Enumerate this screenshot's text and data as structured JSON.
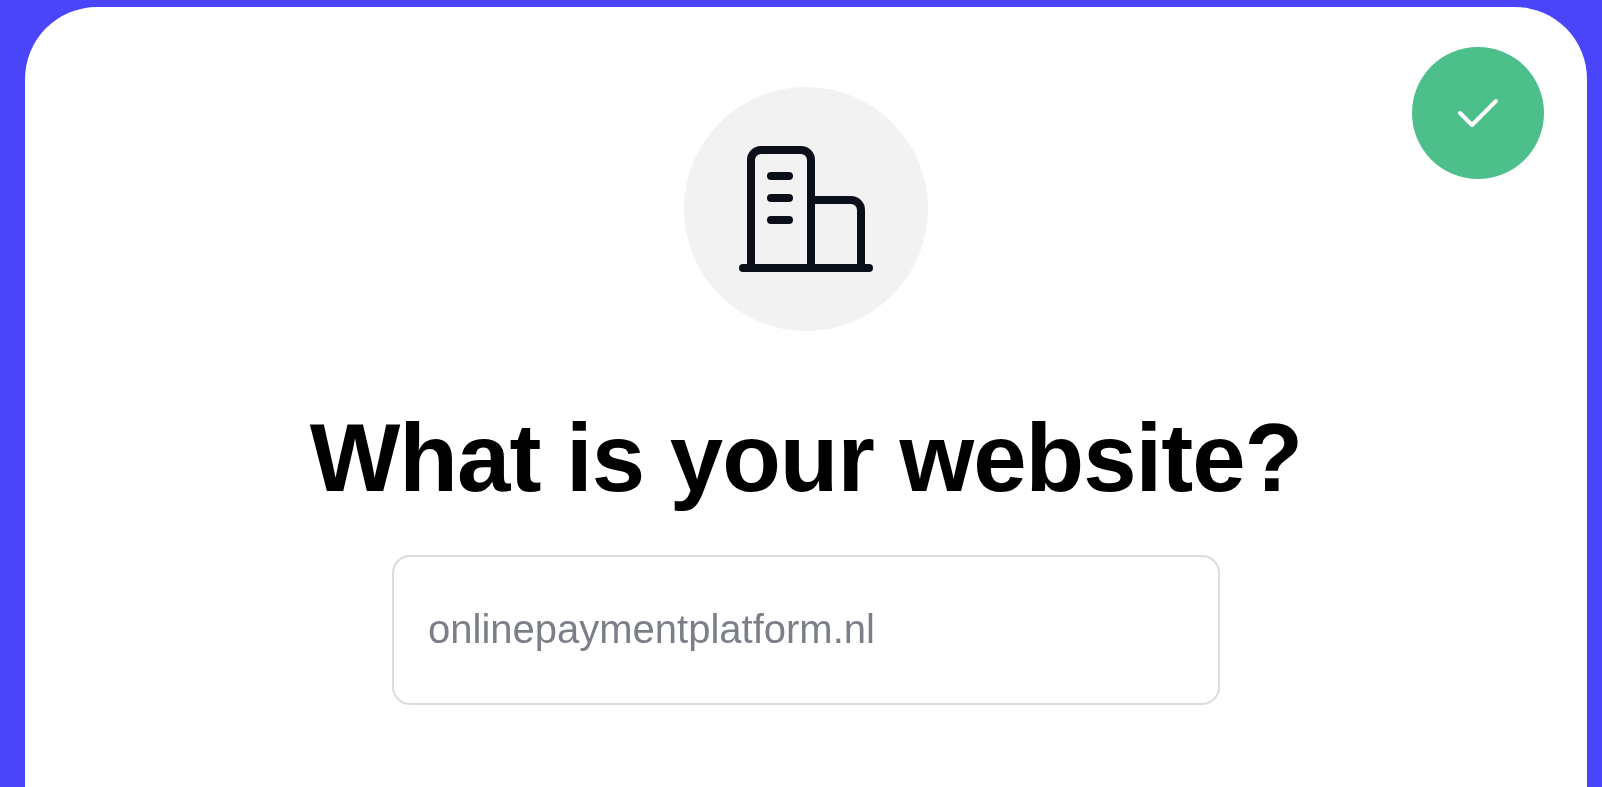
{
  "confirm_button": {
    "checked": true
  },
  "heading": "What is your website?",
  "website_field": {
    "placeholder": "onlinepaymentplatform.nl"
  }
}
